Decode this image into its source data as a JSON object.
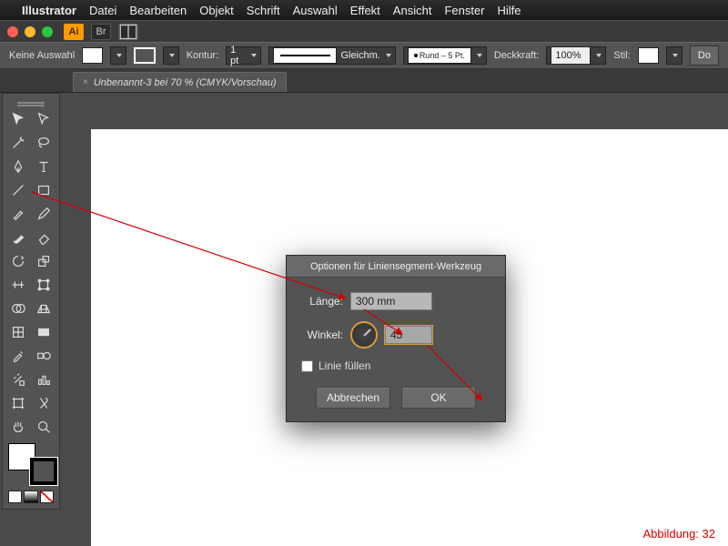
{
  "menubar": {
    "apple": "",
    "app": "Illustrator",
    "items": [
      "Datei",
      "Bearbeiten",
      "Objekt",
      "Schrift",
      "Auswahl",
      "Effekt",
      "Ansicht",
      "Fenster",
      "Hilfe"
    ]
  },
  "titlebar": {
    "badge": "Ai",
    "br": "Br"
  },
  "controlbar": {
    "selection": "Keine Auswahl",
    "kontur_label": "Kontur:",
    "kontur_value": "1 pt",
    "stroke_style": "Gleichm.",
    "brush_label": "Rund – 5 Pt.",
    "deckkraft_label": "Deckkraft:",
    "deckkraft_value": "100%",
    "stil_label": "Stil:",
    "do_label": "Do"
  },
  "tab": {
    "label": "Unbenannt-3 bei 70 % (CMYK/Vorschau)"
  },
  "dialog": {
    "title": "Optionen für Liniensegment-Werkzeug",
    "length_label": "Länge:",
    "length_value": "300 mm",
    "angle_label": "Winkel:",
    "angle_value": "45",
    "fill_label": "Linie füllen",
    "cancel": "Abbrechen",
    "ok": "OK"
  },
  "caption": "Abbildung: 32"
}
